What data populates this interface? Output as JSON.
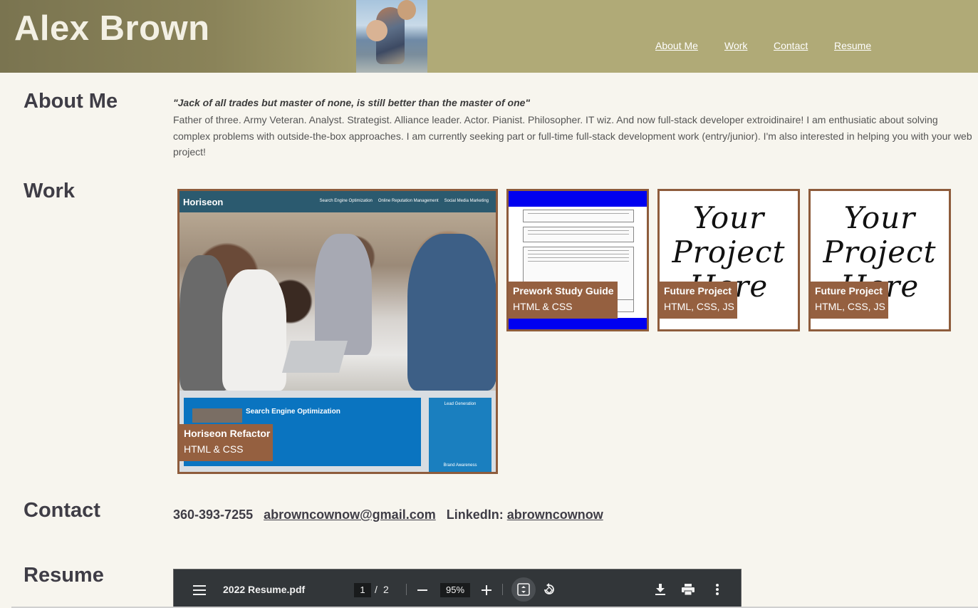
{
  "header": {
    "name": "Alex Brown",
    "nav": [
      "About Me",
      "Work",
      "Contact",
      "Resume"
    ]
  },
  "about": {
    "heading": "About Me",
    "quote": "\"Jack of all trades but master of none, is still better than the master of one\"",
    "text": "Father of three. Army Veteran. Analyst. Strategist. Alliance leader. Actor. Pianist. Philosopher. IT wiz. And now full-stack developer extroidinaire! I am enthusiatic about solving complex problems with outside-the-box approaches. I am currently seeking part or full-time full-stack development work (entry/junior). I'm also interested in helping you with your web project!"
  },
  "work": {
    "heading": "Work",
    "projects": [
      {
        "title": "Horiseon Refactor",
        "tech": "HTML & CSS"
      },
      {
        "title": "Prework Study Guide",
        "tech": "HTML & CSS"
      },
      {
        "title": "Future Project",
        "tech": "HTML, CSS, JS"
      },
      {
        "title": "Future Project",
        "tech": "HTML, CSS, JS"
      }
    ],
    "horiseon_preview": {
      "logo": "Horiseon",
      "nav": [
        "Search Engine Optimization",
        "Online Reputation Management",
        "Social Media Marketing"
      ],
      "panel_title": "Search Engine Optimization",
      "side_title": "Lead Generation",
      "side_bottom": "Brand Awareness"
    },
    "future_preview_text": "Your Project Here"
  },
  "contact": {
    "heading": "Contact",
    "phone": "360-393-7255",
    "email": "abrowncownow@gmail.com",
    "linkedin_label": "LinkedIn:",
    "linkedin_handle": "abrowncownow"
  },
  "resume": {
    "heading": "Resume",
    "pdf_toolbar": {
      "file_name": "2022 Resume.pdf",
      "current_page": "1",
      "page_separator": "/",
      "total_pages": "2",
      "zoom": "95%",
      "icons": [
        "menu-icon",
        "zoom-out-icon",
        "zoom-in-icon",
        "fit-page-icon",
        "rotate-icon",
        "download-icon",
        "print-icon",
        "more-options-icon"
      ]
    }
  },
  "colors": {
    "header": "#b0aa77",
    "card_border": "#8e5c3c",
    "label_bg": "#956040",
    "background": "#f7f5ee"
  }
}
